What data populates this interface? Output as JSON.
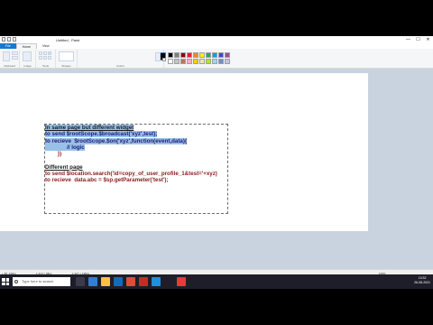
{
  "window": {
    "title": "Untitled - Paint",
    "controls": [
      "—",
      "☐",
      "✕"
    ]
  },
  "tabs": [
    "File",
    "Home",
    "View"
  ],
  "ribbon": {
    "groups": [
      "Clipboard",
      "Image",
      "Tools",
      "Shapes",
      "Size",
      "Colors"
    ],
    "color1": "#000000",
    "color2": "#ffffff",
    "palette": [
      "#000000",
      "#7f7f7f",
      "#880015",
      "#ed1c24",
      "#ff7f27",
      "#fff200",
      "#22b14c",
      "#00a2e8",
      "#3f48cc",
      "#a349a4",
      "#ffffff",
      "#c3c3c3",
      "#b97a57",
      "#ffaec9",
      "#ffc90e",
      "#efe4b0",
      "#b5e61d",
      "#99d9ea",
      "#7092be",
      "#c8bfe7"
    ]
  },
  "document": {
    "lines": [
      {
        "text": "In same page but different widget",
        "style": "hl-u"
      },
      {
        "text": "to send $rootScope.$broadcast('xyz',test);",
        "style": "hl"
      },
      {
        "text": "to recieve  $rootScope.$on('xyz',function(event,data){",
        "style": "hl"
      },
      {
        "text": "              // logic",
        "style": "hl"
      },
      {
        "text": "        })",
        "style": "plain"
      },
      {
        "text": "",
        "style": "plain"
      },
      {
        "text": "Different page",
        "style": "u"
      },
      {
        "text": "to send $location.search('id=copy_of_user_profile_1&test='+xyz)",
        "style": "plain"
      },
      {
        "text": "to recieve  data.abc = $sp.getParameter('test');",
        "style": "plain"
      }
    ]
  },
  "status": {
    "cursor": "+  98, 140px",
    "selection": "1  213 × 98px",
    "size": "1  327 × 198px",
    "zoom": "100%"
  },
  "taskbar": {
    "search_placeholder": "Type here to search",
    "time": "13:32",
    "date": "26-08-2021"
  }
}
